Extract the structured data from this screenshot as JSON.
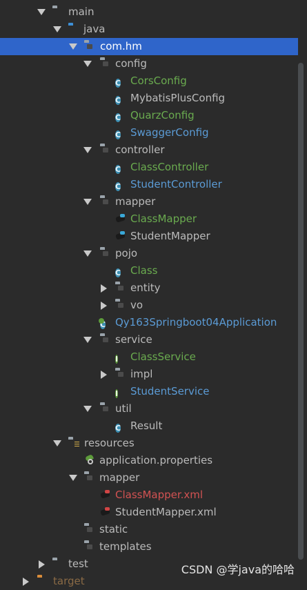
{
  "tree": {
    "main": "main",
    "java": "java",
    "package": "com.hm",
    "config": {
      "folder": "config",
      "items": [
        "CorsConfig",
        "MybatisPlusConfig",
        "QuarzConfig",
        "SwaggerConfig"
      ]
    },
    "controller": {
      "folder": "controller",
      "items": [
        "ClassController",
        "StudentController"
      ]
    },
    "mapper": {
      "folder": "mapper",
      "items": [
        "ClassMapper",
        "StudentMapper"
      ]
    },
    "pojo": {
      "folder": "pojo",
      "class_item": "Class",
      "entity": "entity",
      "vo": "vo"
    },
    "application": "Qy163Springboot04Application",
    "service": {
      "folder": "service",
      "class_service": "ClassService",
      "impl": "impl",
      "student_service": "StudentService"
    },
    "util": {
      "folder": "util",
      "result": "Result"
    },
    "resources": "resources",
    "application_properties": "application.properties",
    "resources_mapper": {
      "folder": "mapper",
      "items": [
        "ClassMapper.xml",
        "StudentMapper.xml"
      ]
    },
    "static": "static",
    "templates": "templates",
    "test": "test",
    "target": "target"
  },
  "watermark": "CSDN @学java的哈哈",
  "colors": {
    "background": "#2b2b2b",
    "selection": "#2f65ca",
    "green": "#6aab4f",
    "blue": "#5b9bd5",
    "red": "#d25252"
  }
}
